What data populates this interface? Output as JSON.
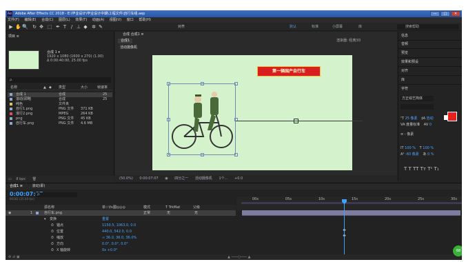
{
  "window": {
    "title": "Adobe After Effects CC 2018 - E:\\毕业设计\\毕业设计中期\\工程文件\\自行车组.aep",
    "logo_text": "Ae",
    "minimize": "—",
    "maximize": "□",
    "close": "✕"
  },
  "menu": [
    "文件(F)",
    "编辑(E)",
    "合成(C)",
    "图层(L)",
    "效果(T)",
    "动画(A)",
    "视图(V)",
    "窗口",
    "帮助(H)"
  ],
  "toolbar": {
    "tools": [
      "▶",
      "✋",
      "🔍",
      "↻",
      "✥",
      "⬚",
      "✒",
      "T",
      "/",
      "⊥",
      "◆",
      "✲",
      "✎"
    ],
    "align_label": "对齐",
    "workspaces": [
      "默认",
      "标准",
      "小屏幕",
      "库"
    ],
    "active_workspace": "默认",
    "search_placeholder": "搜索帮助"
  },
  "project": {
    "panel_title": "项目 ≡",
    "comp_name": "合成 1 ▾",
    "comp_info_1": "1920 x 1080 (1600 x 270) (1.00)",
    "comp_info_2": "Δ 0:00:40:00, 25.00 fps",
    "search_placeholder": "ρ.",
    "columns": [
      "名称",
      "▲",
      "◆",
      "类型",
      "大小",
      "帧速率"
    ],
    "items": [
      {
        "name": "合成 1",
        "type": "合成",
        "size": "",
        "fps": "25",
        "color": "#8fa7cf"
      },
      {
        "name": "滚动(即略",
        "type": "合成",
        "size": "",
        "fps": "25",
        "color": "#8fa7cf"
      },
      {
        "name": "纯色",
        "type": "文件夹",
        "size": "",
        "fps": "",
        "color": "#e1c35a"
      },
      {
        "name": "自行1.png",
        "type": "PNG 文件",
        "size": "371 KB",
        "fps": "",
        "color": "#8fa7cf"
      },
      {
        "name": "滚行2.png",
        "type": "MPEG",
        "size": "264 KB",
        "fps": "",
        "color": "#e05050"
      },
      {
        "name": "png",
        "type": "PNG 文件",
        "size": "45 KB",
        "fps": "",
        "color": "#8fa7cf"
      },
      {
        "name": "自行车.png",
        "type": "PNG 文件",
        "size": "4.6 MB",
        "fps": "",
        "color": "#8fa7cf"
      }
    ],
    "footer": "8 bpc"
  },
  "composition": {
    "panel_title": "合成 合成1 ≡",
    "tab": "合成1",
    "renderer": "渲染器: 经典3D",
    "layer_label": "活动摄像机",
    "banner_text": "第一辆国产自行车",
    "footer": {
      "zoom": "(50.0%)",
      "time": "0:00:07:07",
      "resolution": "四分之一",
      "camera": "活动摄像机",
      "views": "1个...",
      "exposure": "+0.0"
    }
  },
  "right_panel": {
    "items": [
      "信息",
      "音频",
      "预览",
      "效果和预设",
      "对齐",
      "库",
      "字符"
    ],
    "font": "方正综艺简体",
    "font_size": "25 像素",
    "leading": "自动",
    "tracking_label": "度量标准",
    "tracking_value": "0",
    "stroke_width": "- 像素",
    "scale_v": "100 %",
    "scale_h": "100 %",
    "baseline": "-60 像素",
    "tsume": "0 %",
    "stroke_color": "#ffffff",
    "fill_color": "#e82020"
  },
  "timeline": {
    "tabs": [
      "合成1 ≡",
      "滚动(即)"
    ],
    "timecode": "0:00:07:07",
    "frame_info": "00182 (25.00 fps)",
    "search_placeholder": "ρ.",
    "columns": [
      "源名称",
      "单☆\\fx圃◎◎◎",
      "模式",
      "T TrkMat",
      "父级"
    ],
    "layer": {
      "index": "1",
      "name": "自行车.png",
      "mode": "正常",
      "trkmat": "无",
      "parent": "无"
    },
    "properties": [
      {
        "name": "变换",
        "value": "重置"
      },
      {
        "name": "锚点",
        "value": "1150.5, 1063.0, 0.0"
      },
      {
        "name": "位置",
        "value": "440.0, 542.0, 0.0"
      },
      {
        "name": "缩放",
        "value": "∞ 36.0, 36.0, 36.0%"
      },
      {
        "name": "方向",
        "value": "0.0°, 0.0°, 0.0°"
      },
      {
        "name": "X 轴旋转",
        "value": "0x +0.0°"
      }
    ],
    "ticks": [
      "00s",
      "05s",
      "10s",
      "15s",
      "20s",
      "25s",
      "30s"
    ],
    "playhead_seconds": 7.28,
    "badge": "68"
  }
}
